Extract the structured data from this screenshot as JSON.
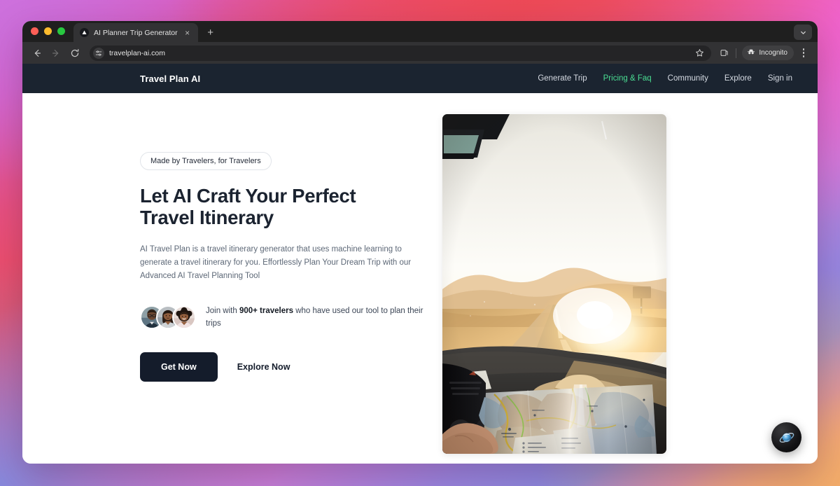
{
  "browser": {
    "tab": {
      "title": "AI Planner Trip Generator",
      "favicon_icon": "mountain-triangle-icon",
      "close_icon": "×",
      "new_tab_icon": "+"
    },
    "toolbar": {
      "back_icon": "arrow-left-icon",
      "forward_icon": "arrow-right-icon",
      "reload_icon": "reload-icon",
      "site_settings_icon": "sliders-icon",
      "url": "travelplan-ai.com",
      "bookmark_icon": "star-icon",
      "split_view_icon": "copy-icon",
      "incognito_label": "Incognito",
      "incognito_icon": "incognito-hat-icon",
      "menu_icon": "kebab-menu-icon",
      "window_chevron_icon": "chevron-down-icon"
    },
    "traffic_lights": {
      "close": "#ff5f57",
      "minimize": "#febc2e",
      "zoom": "#28c840"
    }
  },
  "site": {
    "nav": {
      "brand": "Travel Plan AI",
      "links": [
        {
          "label": "Generate Trip",
          "active": false
        },
        {
          "label": "Pricing & Faq",
          "active": true
        },
        {
          "label": "Community",
          "active": false
        },
        {
          "label": "Explore",
          "active": false
        },
        {
          "label": "Sign in",
          "active": false
        }
      ],
      "background": "#1b2430",
      "active_color": "#4ade93"
    },
    "hero": {
      "badge": "Made by Travelers, for Travelers",
      "title": "Let AI Craft Your Perfect Travel Itinerary",
      "subtitle": "AI Travel Plan is a travel itinerary generator that uses machine learning to generate a travel itinerary for you. Effortlessly Plan Your Dream Trip with our Advanced AI Travel Planning Tool",
      "social_proof": {
        "prefix": "Join with ",
        "highlight": "900+ travelers",
        "suffix": " who have used our tool to plan their trips",
        "avatar_count": 3
      },
      "primary_cta": "Get Now",
      "secondary_cta": "Explore Now",
      "image_alt": "road-trip-sunset-with-paper-map-photo"
    },
    "fab": {
      "icon": "globe-planet-icon"
    }
  },
  "theme": {
    "page_background": "#ffffff",
    "text_dark": "#1b2330",
    "text_muted": "#5d6877",
    "button_dark": "#141c2b",
    "backdrop_gradient_stops": [
      "#c86ddc",
      "#ef4d5f",
      "#e96bb8",
      "#8a8ade",
      "#f2ad6e"
    ]
  }
}
